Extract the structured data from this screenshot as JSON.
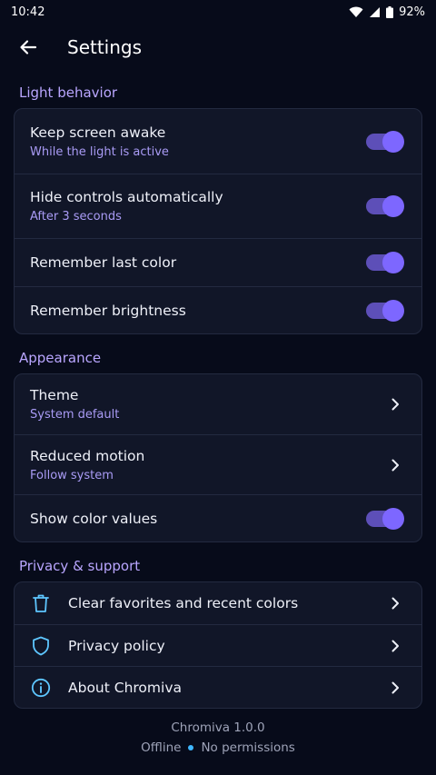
{
  "status_bar": {
    "time": "10:42",
    "battery": "92%",
    "icons": [
      "wifi-icon",
      "cellular-icon",
      "battery-icon"
    ]
  },
  "app_bar": {
    "title": "Settings",
    "back_icon": "arrow-left-icon"
  },
  "sections": {
    "light": {
      "title": "Light behavior",
      "items": [
        {
          "label": "Keep screen awake",
          "sub": "While the light is active",
          "on": true
        },
        {
          "label": "Hide controls automatically",
          "sub": "After 3 seconds",
          "on": true
        },
        {
          "label": "Remember last color",
          "on": true
        },
        {
          "label": "Remember brightness",
          "on": true
        }
      ]
    },
    "appearance": {
      "title": "Appearance",
      "items": [
        {
          "label": "Theme",
          "sub": "System default"
        },
        {
          "label": "Reduced motion",
          "sub": "Follow system"
        },
        {
          "label": "Show color values",
          "on": true
        }
      ]
    },
    "privacy": {
      "title": "Privacy & support",
      "items": [
        {
          "label": "Clear favorites and recent colors",
          "icon": "trash-icon"
        },
        {
          "label": "Privacy policy",
          "icon": "shield-icon"
        },
        {
          "label": "About Chromiva",
          "icon": "info-icon"
        }
      ]
    }
  },
  "footer": {
    "version": "Chromiva 1.0.0",
    "status_left": "Offline",
    "status_right": "No permissions"
  },
  "colors": {
    "background": "#070b1a",
    "card": "#111628",
    "accent": "#7d67ff",
    "section_title": "#b9a6ff",
    "icon_accent": "#5ec6ff"
  }
}
